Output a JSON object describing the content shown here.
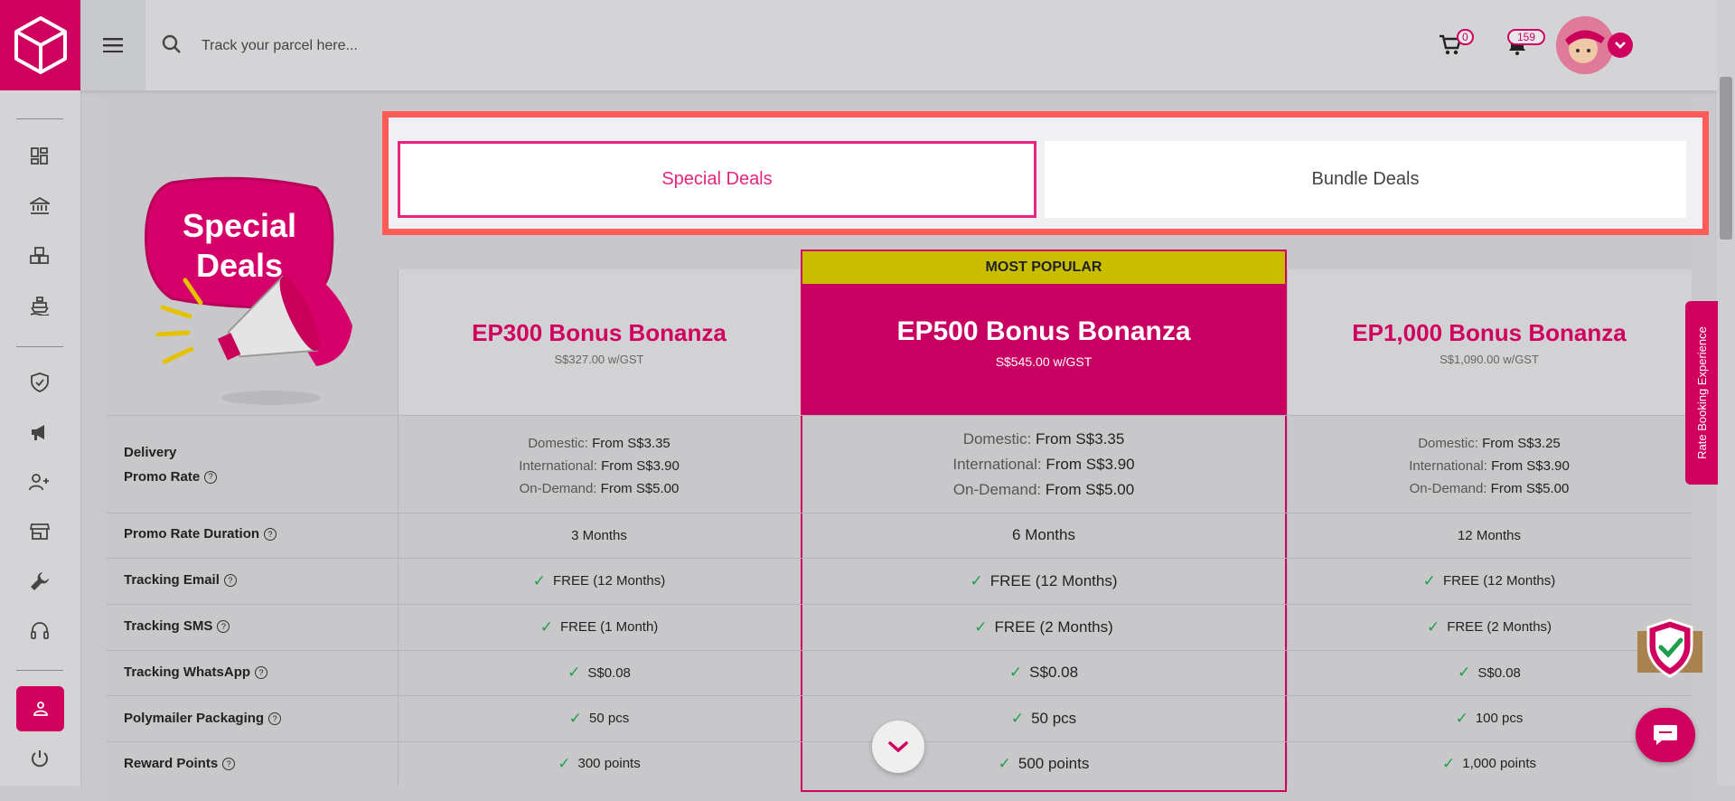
{
  "topbar": {
    "search_placeholder": "Track your parcel here...",
    "cart_count": "0",
    "notification_count": "159"
  },
  "tabs": [
    {
      "label": "Special Deals"
    },
    {
      "label": "Bundle Deals"
    }
  ],
  "promo": {
    "line1": "Special",
    "line2": "Deals"
  },
  "popular_tag": "MOST POPULAR",
  "plans": [
    {
      "name": "EP300 Bonus Bonanza",
      "price": "S$327.00 w/GST",
      "domestic": "From S$3.35",
      "international": "From S$3.90",
      "on_demand": "From S$5.00",
      "duration": "3 Months",
      "tracking_email": "FREE (12 Months)",
      "tracking_sms": "FREE (1 Month)",
      "tracking_whatsapp": "S$0.08",
      "polymailer": "50 pcs",
      "reward_points": "300 points"
    },
    {
      "name": "EP500 Bonus Bonanza",
      "price": "S$545.00 w/GST",
      "domestic": "From S$3.35",
      "international": "From S$3.90",
      "on_demand": "From S$5.00",
      "duration": "6 Months",
      "tracking_email": "FREE (12 Months)",
      "tracking_sms": "FREE (2 Months)",
      "tracking_whatsapp": "S$0.08",
      "polymailer": "50 pcs",
      "reward_points": "500 points"
    },
    {
      "name": "EP1,000 Bonus Bonanza",
      "price": "S$1,090.00 w/GST",
      "domestic": "From S$3.25",
      "international": "From S$3.90",
      "on_demand": "From S$5.00",
      "duration": "12 Months",
      "tracking_email": "FREE (12 Months)",
      "tracking_sms": "FREE (2 Months)",
      "tracking_whatsapp": "S$0.08",
      "polymailer": "100 pcs",
      "reward_points": "1,000 points"
    }
  ],
  "rate_labels": {
    "domestic": "Domestic:",
    "international": "International:",
    "on_demand": "On-Demand:"
  },
  "row_labels": {
    "delivery_line1": "Delivery",
    "delivery_line2": "Promo Rate",
    "duration": "Promo Rate Duration",
    "tracking_email": "Tracking Email",
    "tracking_sms": "Tracking SMS",
    "tracking_whatsapp": "Tracking WhatsApp",
    "polymailer": "Polymailer Packaging",
    "reward_points": "Reward Points"
  },
  "side_tab": "Rate Booking Experience",
  "colors": {
    "brand": "#d0005f",
    "popular": "#c9bd00",
    "highlight": "#ff5b57",
    "check": "#1e9e4a"
  }
}
